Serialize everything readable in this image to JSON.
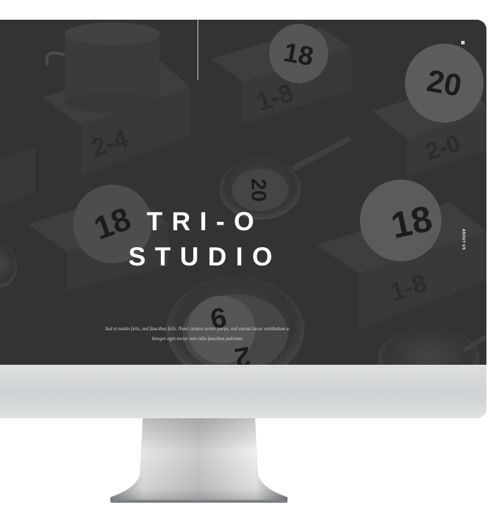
{
  "site": {
    "hero_title_line1": "TRI-O",
    "hero_title_line2": "STUDIO",
    "description_line1": "Sed et mattis felis, sed faucibus felis. Nunc ornare tortor purus, sed varius lacus vestibulum a.",
    "description_line2": "Integer eget tortor non odio faucibus pulvinar.",
    "side_nav_label": "ABOUT US"
  },
  "background_art": {
    "disc_numbers": [
      "18",
      "20",
      "18",
      "18",
      "20",
      "9",
      "2"
    ],
    "box_numbers": [
      "2-4",
      "1-8",
      "2-0",
      "1-8"
    ]
  },
  "colors": {
    "screen_bg": "#3a3a3a",
    "text": "#ffffff",
    "bezel": "#dadcde"
  }
}
